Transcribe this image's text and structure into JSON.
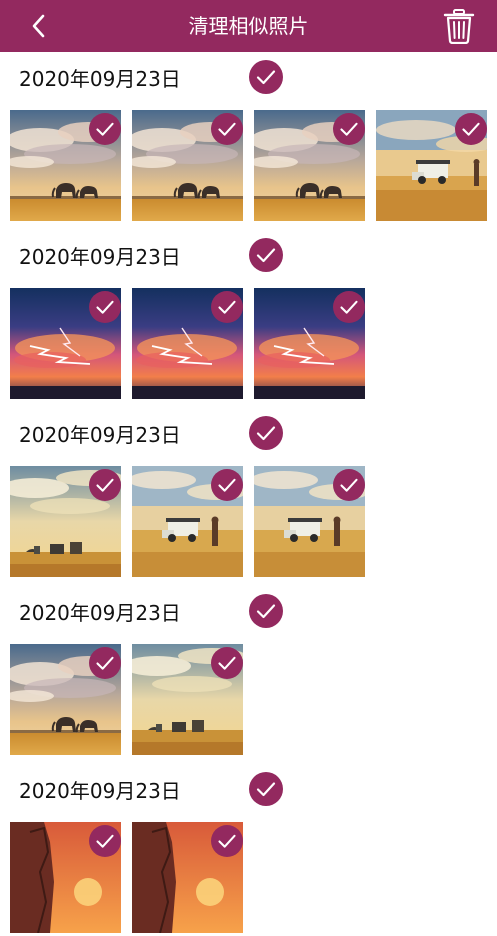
{
  "header": {
    "title": "清理相似照片",
    "back_icon": "chevron-left-icon",
    "trash_icon": "trash-icon"
  },
  "theme": {
    "accent": "#93295f",
    "text": "#111111",
    "background": "#ffffff"
  },
  "groups": [
    {
      "date": "2020年09月23日",
      "selected": true,
      "photos": [
        {
          "scene": "elephants-clouds",
          "selected": true
        },
        {
          "scene": "elephants-clouds",
          "selected": true
        },
        {
          "scene": "elephants-clouds",
          "selected": true
        },
        {
          "scene": "safari-jeep-sunset",
          "selected": true
        }
      ]
    },
    {
      "date": "2020年09月23日",
      "selected": true,
      "photos": [
        {
          "scene": "lightning-storm",
          "selected": true
        },
        {
          "scene": "lightning-storm",
          "selected": true
        },
        {
          "scene": "lightning-storm",
          "selected": true
        }
      ]
    },
    {
      "date": "2020年09月23日",
      "selected": true,
      "photos": [
        {
          "scene": "savanna-huts",
          "selected": true
        },
        {
          "scene": "safari-jeep",
          "selected": true
        },
        {
          "scene": "safari-jeep",
          "selected": true
        }
      ]
    },
    {
      "date": "2020年09月23日",
      "selected": true,
      "photos": [
        {
          "scene": "elephants-clouds",
          "selected": true
        },
        {
          "scene": "savanna-huts",
          "selected": true
        }
      ]
    },
    {
      "date": "2020年09月23日",
      "selected": true,
      "photos": [
        {
          "scene": "rock-sunset",
          "selected": true
        },
        {
          "scene": "rock-sunset",
          "selected": true
        }
      ]
    }
  ]
}
